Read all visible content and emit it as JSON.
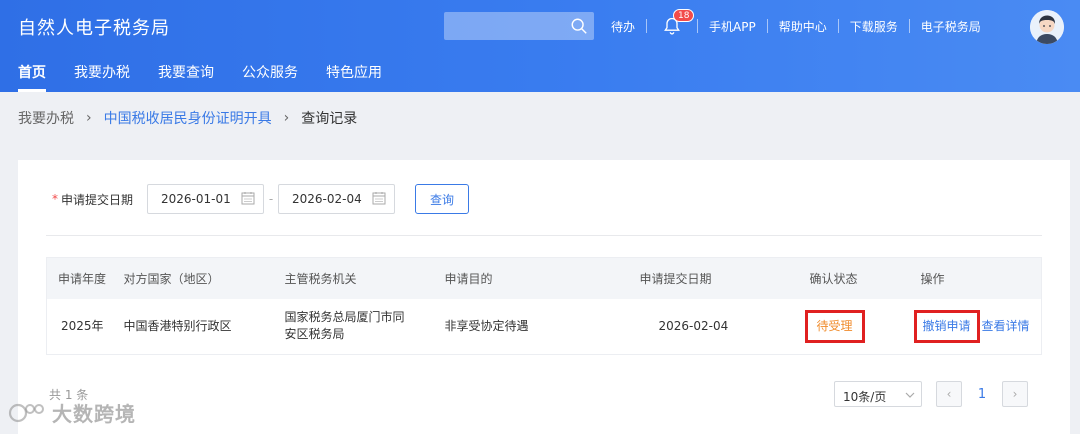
{
  "header": {
    "title": "自然人电子税务局",
    "search": {
      "placeholder": ""
    },
    "links": [
      "待办",
      "手机APP",
      "帮助中心",
      "下载服务",
      "电子税务局"
    ],
    "notification_count": "18",
    "nav_tabs": [
      "首页",
      "我要办税",
      "我要查询",
      "公众服务",
      "特色应用"
    ],
    "active_tab": "首页"
  },
  "breadcrumb": [
    "我要办税",
    "中国税收居民身份证明开具",
    "查询记录"
  ],
  "filter": {
    "required_mark": "*",
    "label": "申请提交日期",
    "start_date": "2026-01-01",
    "separator": "-",
    "end_date": "2026-02-04",
    "query_button": "查询"
  },
  "table": {
    "columns": [
      "申请年度",
      "对方国家（地区）",
      "主管税务机关",
      "申请目的",
      "申请提交日期",
      "确认状态",
      "操作"
    ],
    "rows": [
      {
        "year": "2025年",
        "country": "中国香港特别行政区",
        "authority": "国家税务总局厦门市同安区税务局",
        "purpose": "非享受协定待遇",
        "date": "2026-02-04",
        "status": "待受理",
        "action_revoke": "撤销申请",
        "action_detail": "查看详情"
      }
    ]
  },
  "pagination": {
    "total": "共 1 条",
    "page_size": "10条/页",
    "prev": "‹",
    "current_page": "1",
    "next": "›"
  },
  "watermark": "大数跨境",
  "colors": {
    "header_blue": "#3a7df0",
    "link_blue": "#3a7ae6",
    "status_orange": "#f08c2c",
    "highlight_red": "#e02020"
  }
}
